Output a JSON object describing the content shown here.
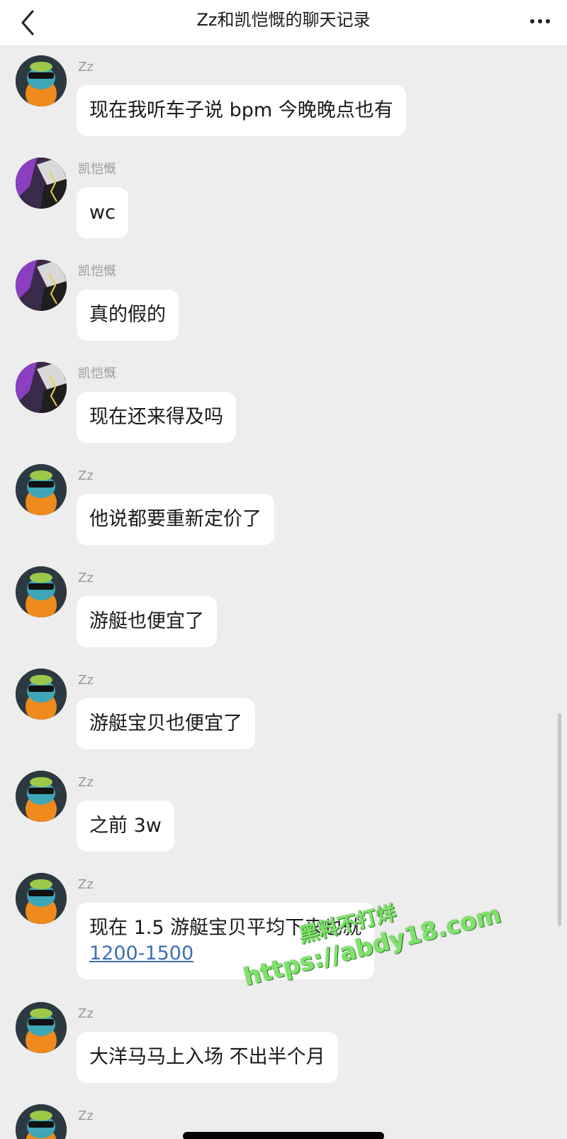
{
  "header": {
    "title": "Zz和凯恺慨的聊天记录",
    "back_icon": "chevron-left-icon",
    "more_icon": "more-dots-icon"
  },
  "messages": [
    {
      "sender": "Zz",
      "text": "现在我听车子说 bpm 今晚晚点也有",
      "avatar": "zz"
    },
    {
      "sender": "凯恺慨",
      "text": "wc",
      "avatar": "kai"
    },
    {
      "sender": "凯恺慨",
      "text": "真的假的",
      "avatar": "kai"
    },
    {
      "sender": "凯恺慨",
      "text": "现在还来得及吗",
      "avatar": "kai"
    },
    {
      "sender": "Zz",
      "text": "他说都要重新定价了",
      "avatar": "zz"
    },
    {
      "sender": "Zz",
      "text": "游艇也便宜了",
      "avatar": "zz"
    },
    {
      "sender": "Zz",
      "text": "游艇宝贝也便宜了",
      "avatar": "zz"
    },
    {
      "sender": "Zz",
      "text": "之前 3w",
      "avatar": "zz"
    },
    {
      "sender": "Zz",
      "text": "现在 1.5 游艇宝贝平均下来也就",
      "link": "1200-1500",
      "avatar": "zz"
    },
    {
      "sender": "Zz",
      "text": "大洋马马上入场 不出半个月",
      "avatar": "zz"
    },
    {
      "sender": "Zz",
      "text": "",
      "avatar": "zz"
    }
  ],
  "watermark": {
    "line1": "黑料不打烊",
    "line2": "https://abdy18.com"
  },
  "colors": {
    "background": "#ededed",
    "bubble": "#ffffff",
    "link": "#3d6fb5",
    "watermark": "#7ee36a"
  }
}
